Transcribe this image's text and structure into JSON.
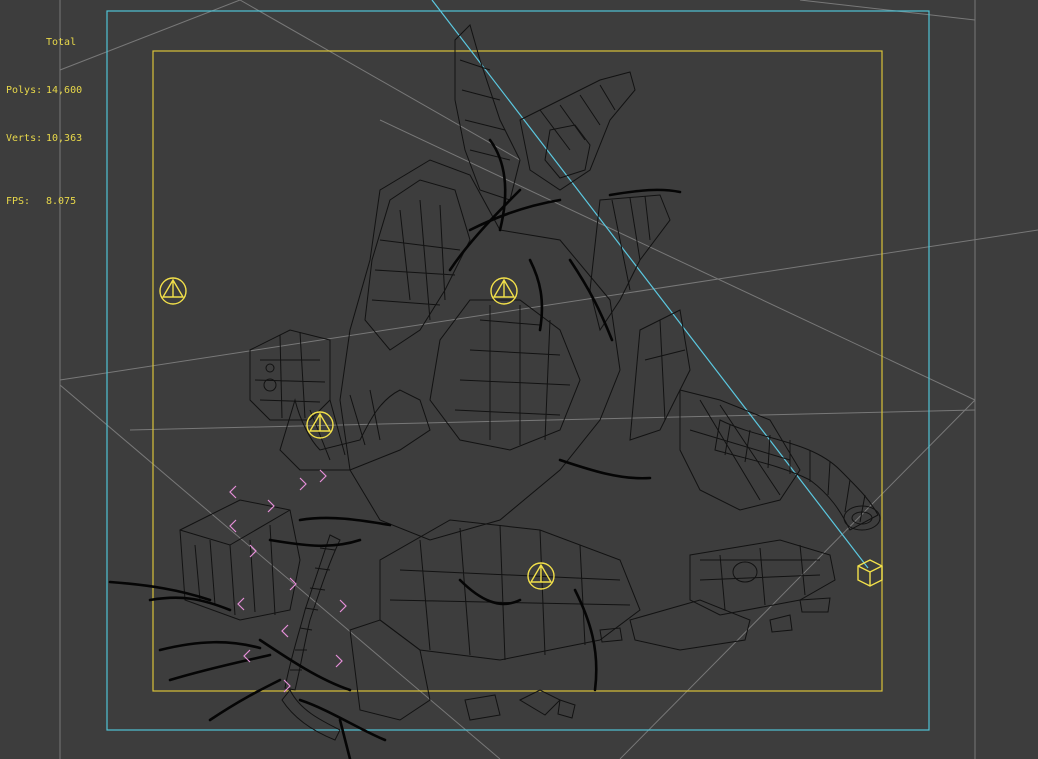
{
  "stats": {
    "title": "Total",
    "polys_label": "Polys:",
    "polys_value": "14,600",
    "verts_label": "Verts:",
    "verts_value": "10,363",
    "fps_label": "FPS:",
    "fps_value": "8.075"
  },
  "colors": {
    "background": "#3d3d3d",
    "wireframe": "#111111",
    "safe_frame_outer": "#4fc3d6",
    "safe_frame_inner": "#d8c23a",
    "grid_lines": "#8a8a8a",
    "light_icon": "#f2e04a",
    "target_marker": "#e58fd8",
    "stats_text": "#e8d84a"
  },
  "icons": [
    "omni-light-icon",
    "target-cube-icon",
    "bracket-marker-icon"
  ]
}
